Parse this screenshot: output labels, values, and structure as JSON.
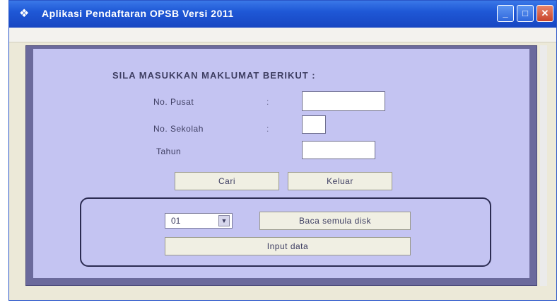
{
  "window": {
    "title": "Aplikasi Pendaftaran OPSB Versi 2011",
    "controls": {
      "minimize": "_",
      "maximize": "□",
      "close": "✕"
    }
  },
  "form": {
    "heading": "SILA MASUKKAN MAKLUMAT BERIKUT :",
    "fields": {
      "no_pusat": {
        "label": "No. Pusat",
        "value": ""
      },
      "no_sekolah": {
        "label": "No. Sekolah",
        "value": ""
      },
      "tahun": {
        "label": "Tahun",
        "value": ""
      }
    },
    "buttons": {
      "cari": "Cari",
      "keluar": "Keluar"
    },
    "group": {
      "select_value": "01",
      "baca_label": "Baca semula disk",
      "input_label": "Input data"
    }
  },
  "icons": {
    "app": "app-icon",
    "dropdown": "chevron-down-icon"
  },
  "colors": {
    "titlebar": "#1f58d6",
    "form_bg": "#c4c4f2",
    "frame": "#6b6a9c"
  }
}
